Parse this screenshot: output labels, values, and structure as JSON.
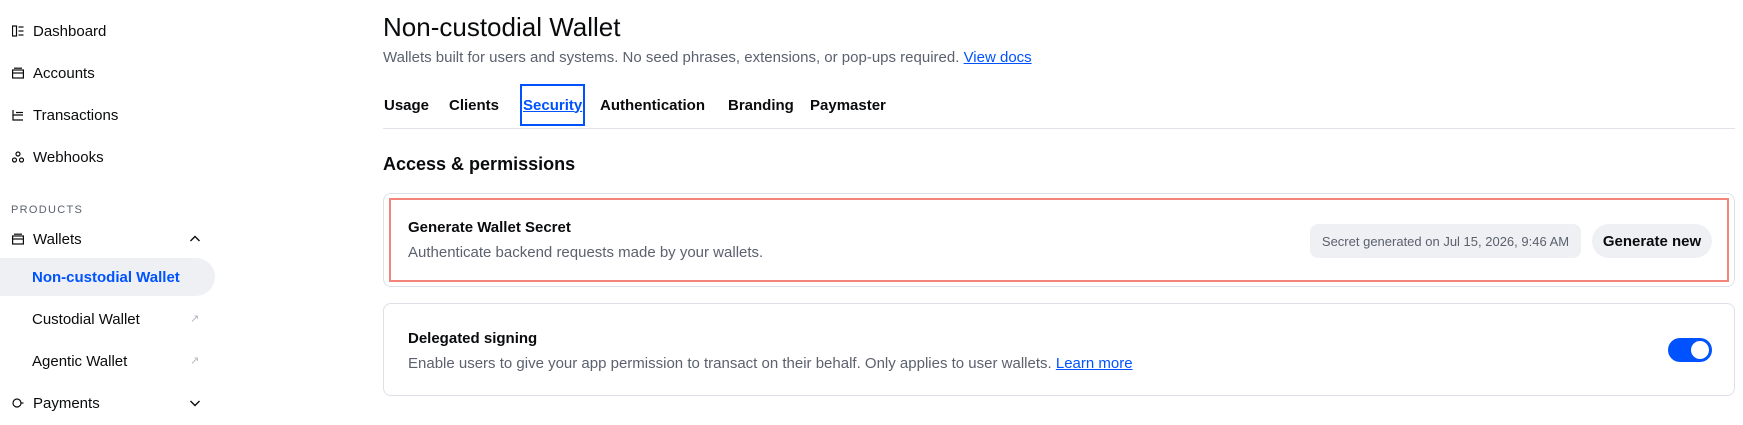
{
  "sidebar": {
    "items": [
      {
        "label": "Dashboard",
        "icon": "dashboard-icon"
      },
      {
        "label": "Accounts",
        "icon": "wallet-icon"
      },
      {
        "label": "Transactions",
        "icon": "transactions-icon"
      },
      {
        "label": "Webhooks",
        "icon": "webhooks-icon"
      }
    ],
    "section_label": "PRODUCTS",
    "wallets": {
      "label": "Wallets",
      "icon": "wallet-icon",
      "expanded": true,
      "children": [
        {
          "label": "Non-custodial Wallet",
          "active": true
        },
        {
          "label": "Custodial Wallet",
          "external": true
        },
        {
          "label": "Agentic Wallet",
          "external": true
        }
      ]
    },
    "payments": {
      "label": "Payments",
      "icon": "payments-icon",
      "expanded": false
    }
  },
  "header": {
    "title": "Non-custodial Wallet",
    "subtitle": "Wallets built for users and systems. No seed phrases, extensions, or pop-ups required.",
    "docs_link": "View docs"
  },
  "tabs": [
    {
      "label": "Usage"
    },
    {
      "label": "Clients"
    },
    {
      "label": "Security",
      "active": true
    },
    {
      "label": "Authentication"
    },
    {
      "label": "Branding"
    },
    {
      "label": "Paymaster"
    }
  ],
  "section_title": "Access & permissions",
  "cards": {
    "secret": {
      "title": "Generate Wallet Secret",
      "description": "Authenticate backend requests made by your wallets.",
      "status": "Secret generated on Jul 15, 2026, 9:46 AM",
      "button": "Generate new"
    },
    "delegated": {
      "title": "Delegated signing",
      "description": "Enable users to give your app permission to transact on their behalf. Only applies to user wallets.",
      "link": "Learn more",
      "enabled": true
    }
  },
  "colors": {
    "accent": "#0052ff",
    "highlight": "#f3857a",
    "muted_text": "#5b616e"
  }
}
